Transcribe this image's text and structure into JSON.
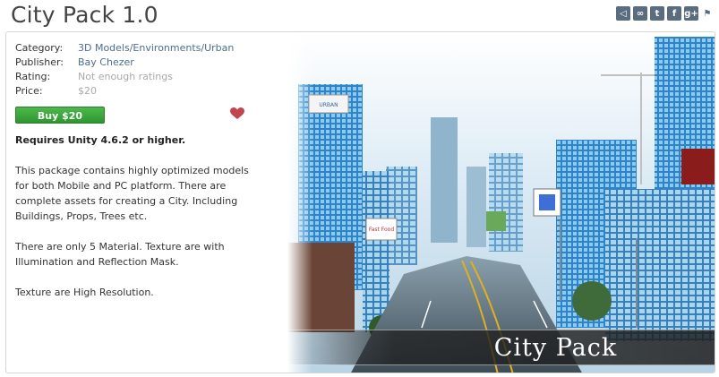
{
  "title": "City Pack 1.0",
  "share_icons": [
    "unity-icon",
    "link-icon",
    "twitter-icon",
    "facebook-icon",
    "googleplus-icon",
    "flag-icon"
  ],
  "info": {
    "category_label": "Category:",
    "category_value": "3D Models/Environments/Urban",
    "publisher_label": "Publisher:",
    "publisher_value": "Bay Chezer",
    "rating_label": "Rating:",
    "rating_value": "Not enough ratings",
    "price_label": "Price:",
    "price_value": "$20"
  },
  "buy_label": "Buy $20",
  "requirement": "Requires Unity 4.6.2 or higher.",
  "description": [
    "This package contains highly optimized models for both Mobile and PC platform. There are complete assets for creating a City. Including Buildings, Props, Trees etc.",
    "There are only 5 Material. Texture are with Illumination and Reflection Mask.",
    "Texture are High Resolution."
  ],
  "hero": {
    "banner_text": "City Pack",
    "billboard_text": "Fast Food"
  },
  "colors": {
    "link": "#4e6d8e",
    "buy_button": "#3aa63a",
    "heart": "#c0474f",
    "share_icon": "#5a6d7f"
  }
}
